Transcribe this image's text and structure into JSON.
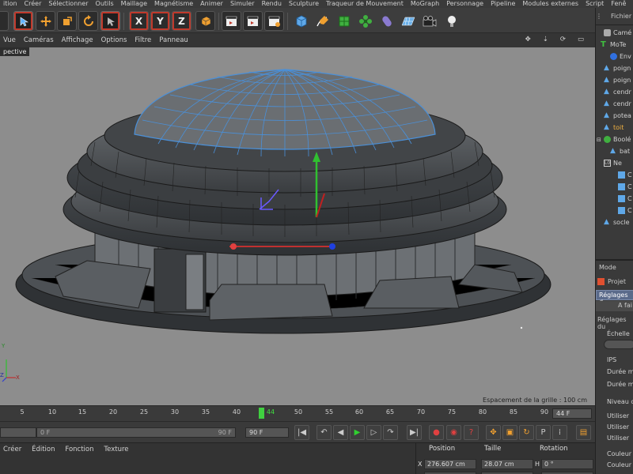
{
  "menubar": {
    "items": [
      "ition",
      "Créer",
      "Sélectionner",
      "Outils",
      "Maillage",
      "Magnétisme",
      "Animer",
      "Simuler",
      "Rendu",
      "Sculpture",
      "Traqueur de Mouvement",
      "MoGraph",
      "Personnage",
      "Pipeline",
      "Modules externes",
      "Script",
      "Fenê"
    ]
  },
  "toolbar": {
    "axis_x": "X",
    "axis_y": "Y",
    "axis_z": "Z"
  },
  "viewport": {
    "menu": [
      "Vue",
      "Caméras",
      "Affichage",
      "Options",
      "Filtre",
      "Panneau"
    ],
    "label": "pective",
    "grid_spacing": "Espacement de la grille : 100 cm",
    "axis_y": "Y",
    "axis_z": "Z",
    "axis_x": "X"
  },
  "timeline": {
    "ticks": [
      "5",
      "10",
      "15",
      "20",
      "25",
      "30",
      "35",
      "40",
      "44",
      "50",
      "55",
      "60",
      "65",
      "70",
      "75",
      "80",
      "85",
      "90"
    ],
    "current_frame": "44",
    "end_field": "44 F"
  },
  "transport": {
    "start_field": "0 F",
    "range_end": "90 F",
    "end_field": "90 F"
  },
  "material_manager": {
    "menu": [
      "Créer",
      "Édition",
      "Fonction",
      "Texture"
    ]
  },
  "coordinates": {
    "headers": [
      "Position",
      "Taille",
      "Rotation"
    ],
    "x_label": "X",
    "x_position": "276.607 cm",
    "x_size": "28.07 cm",
    "h_label": "H",
    "h_value": "0 °"
  },
  "object_manager": {
    "header": "Fichier",
    "items": [
      {
        "label": "Camé",
        "color": "#d0d0d0"
      },
      {
        "label": "MoTe",
        "color": "#d0d0d0"
      },
      {
        "label": "Env",
        "color": "#d0d0d0"
      },
      {
        "label": "poign",
        "color": "#d0d0d0"
      },
      {
        "label": "poign",
        "color": "#d0d0d0"
      },
      {
        "label": "cendr",
        "color": "#d0d0d0"
      },
      {
        "label": "cendr",
        "color": "#d0d0d0"
      },
      {
        "label": "potea",
        "color": "#d0d0d0"
      },
      {
        "label": "toit",
        "color": "#f0b040"
      },
      {
        "label": "Boolé",
        "color": "#d0d0d0"
      },
      {
        "label": "bat",
        "color": "#d0d0d0"
      },
      {
        "label": "Ne",
        "color": "#d0d0d0"
      },
      {
        "label": "C",
        "color": "#d0d0d0"
      },
      {
        "label": "C",
        "color": "#d0d0d0"
      },
      {
        "label": "C",
        "color": "#d0d0d0"
      },
      {
        "label": "C",
        "color": "#d0d0d0"
      },
      {
        "label": "socle",
        "color": "#d0d0d0"
      }
    ]
  },
  "attributes": {
    "mode": "Mode",
    "project": "Projet",
    "tab_reglages": "Réglages d",
    "tab_afai": "A fai",
    "section": "Réglages du",
    "echelle": "Échelle",
    "ips": "IPS",
    "duree1": "Durée m",
    "duree2": "Durée m",
    "niveau": "Niveau c",
    "utiliser1": "Utiliser",
    "utiliser2": "Utiliser",
    "utiliser3": "Utiliser",
    "couleur1": "Couleur",
    "couleur2": "Couleur"
  },
  "colors": {
    "viewport_bg": "#8d8d8d",
    "dome_wire": "#4a90d9",
    "selected_object": "#f0b040"
  }
}
